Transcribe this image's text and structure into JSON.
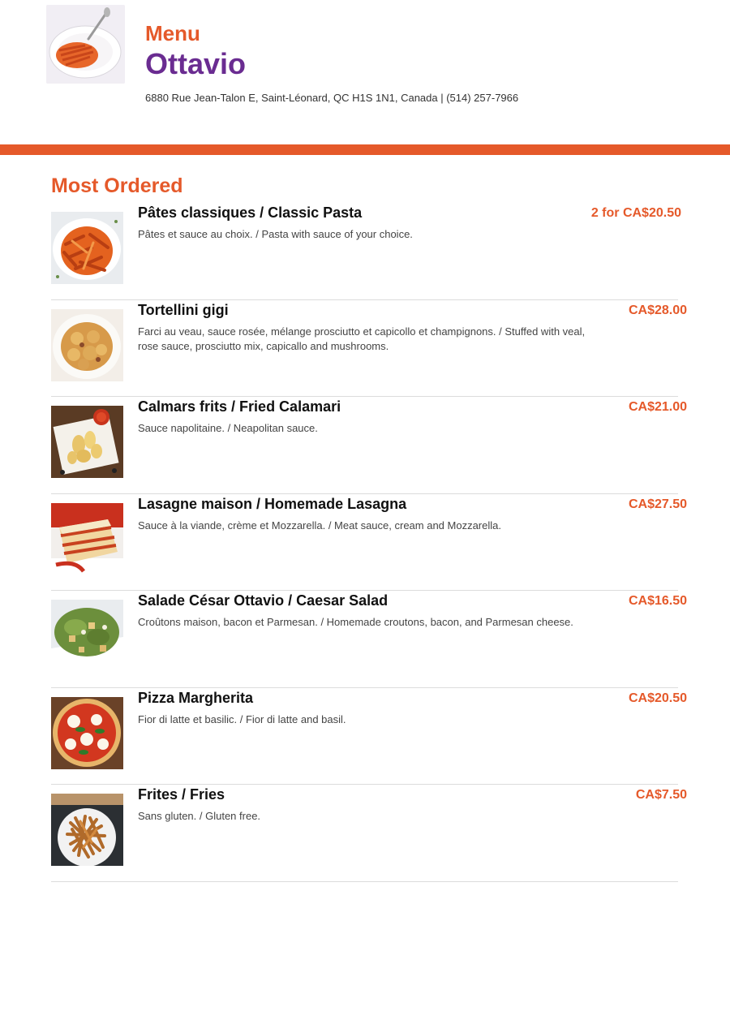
{
  "header": {
    "menu_label": "Menu",
    "restaurant_name": "Ottavio",
    "address": "6880 Rue Jean-Talon E, Saint-Léonard, QC H1S 1N1, Canada | (514) 257-7966"
  },
  "colors": {
    "accent": "#e5592a",
    "brand": "#6a2c91"
  },
  "section": {
    "title": "Most Ordered"
  },
  "items": [
    {
      "name": "Pâtes classiques / Classic Pasta",
      "description": "Pâtes et sauce au choix. / Pasta with sauce of your choice.",
      "price": "2 for CA$20.50",
      "image": "penne-pasta-photo"
    },
    {
      "name": "Tortellini gigi",
      "description": "Farci au veau, sauce rosée, mélange prosciutto et capicollo et champignons. / Stuffed with veal, rose sauce, prosciutto mix, capicallo and mushrooms.",
      "price": "CA$28.00",
      "image": "tortellini-photo"
    },
    {
      "name": "Calmars frits / Fried Calamari",
      "description": "Sauce napolitaine. / Neapolitan sauce.",
      "price": "CA$21.00",
      "image": "calamari-photo"
    },
    {
      "name": "Lasagne maison / Homemade Lasagna",
      "description": "Sauce à la viande, crème et Mozzarella. / Meat sauce, cream and Mozzarella.",
      "price": "CA$27.50",
      "image": "lasagna-photo"
    },
    {
      "name": "Salade César Ottavio / Caesar Salad",
      "description": "Croûtons maison, bacon et Parmesan. / Homemade croutons, bacon, and Parmesan cheese.",
      "price": "CA$16.50",
      "image": "caesar-salad-photo"
    },
    {
      "name": "Pizza Margherita",
      "description": "Fior di latte et basilic. / Fior di latte and basil.",
      "price": "CA$20.50",
      "image": "pizza-photo"
    },
    {
      "name": "Frites / Fries",
      "description": "Sans gluten. / Gluten free.",
      "price": "CA$7.50",
      "image": "fries-photo"
    }
  ]
}
